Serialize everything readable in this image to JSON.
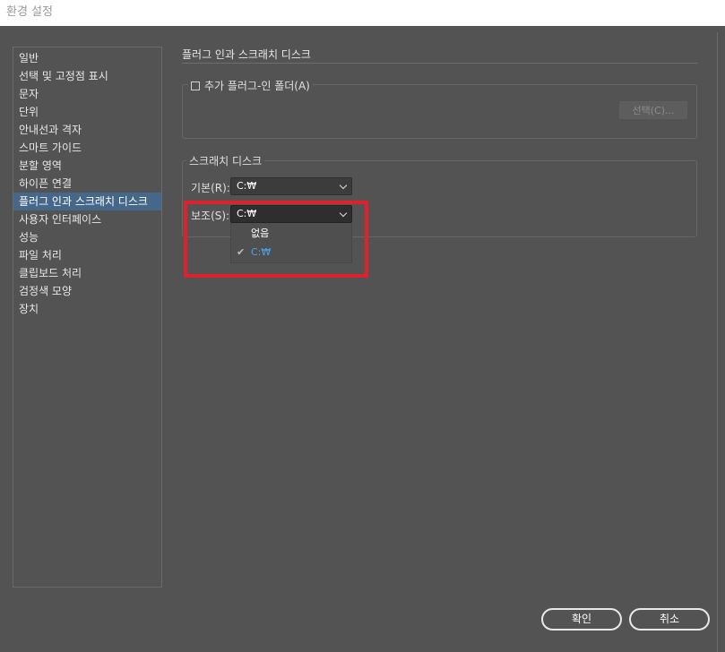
{
  "window": {
    "title": "환경 설정"
  },
  "sidebar": {
    "items": [
      {
        "label": "일반"
      },
      {
        "label": "선택 및 고정점 표시"
      },
      {
        "label": "문자"
      },
      {
        "label": "단위"
      },
      {
        "label": "안내선과 격자"
      },
      {
        "label": "스마트 가이드"
      },
      {
        "label": "분할 영역"
      },
      {
        "label": "하이픈 연결"
      },
      {
        "label": "플러그 인과 스크래치 디스크",
        "selected": true
      },
      {
        "label": "사용자 인터페이스"
      },
      {
        "label": "성능"
      },
      {
        "label": "파일 처리"
      },
      {
        "label": "클립보드 처리"
      },
      {
        "label": "검정색 모양"
      },
      {
        "label": "장치"
      }
    ]
  },
  "panel": {
    "title": "플러그 인과 스크래치 디스크",
    "plugins": {
      "checkbox_label": "추가 플러그-인 폴더(A)",
      "checked": false,
      "choose_button": "선택(C)..."
    },
    "scratch": {
      "legend": "스크래치 디스크",
      "primary_label": "기본(R):",
      "primary_value": "C:₩",
      "secondary_label": "보조(S):",
      "secondary_value": "C:₩",
      "dropdown_options": [
        {
          "label": "없음",
          "selected": false
        },
        {
          "label": "C:₩",
          "selected": true
        }
      ]
    }
  },
  "footer": {
    "ok": "확인",
    "cancel": "취소"
  },
  "colors": {
    "highlight": "#e0202a",
    "selected": "#45688a",
    "selected_option": "#4aa3ea"
  }
}
